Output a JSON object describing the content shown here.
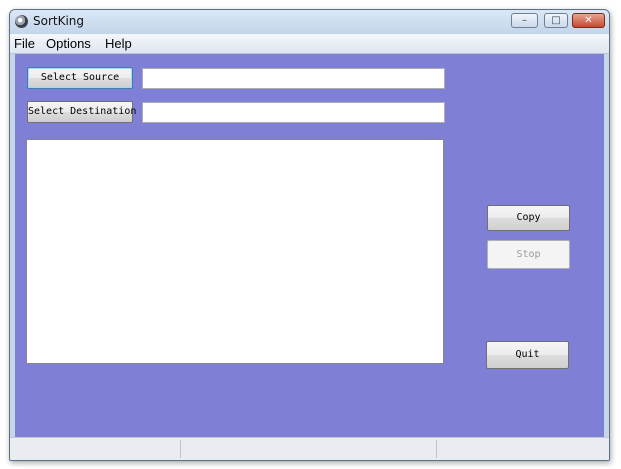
{
  "window": {
    "title": "SortKing",
    "controls": {
      "minimize": "–",
      "maximize": "□",
      "close": "✕"
    }
  },
  "menu": {
    "items": [
      "File",
      "Options",
      "Help"
    ]
  },
  "form": {
    "select_source_label": "Select Source",
    "source_value": "",
    "select_destination_label": "Select Destination",
    "destination_value": ""
  },
  "actions": {
    "copy_label": "Copy",
    "stop_label": "Stop",
    "quit_label": "Quit"
  },
  "colors": {
    "client_background": "#7f7fd5",
    "titlebar": "#c6d7ea"
  }
}
